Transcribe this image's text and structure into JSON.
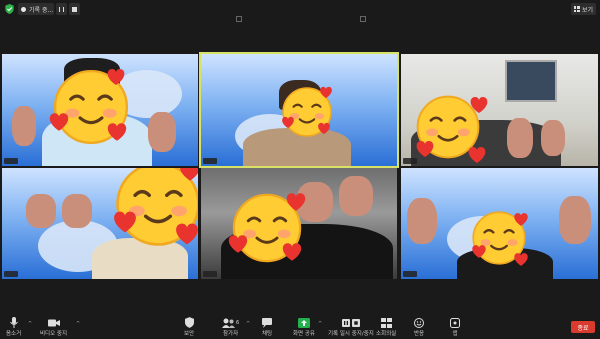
{
  "top_bar": {
    "recording_label": "기록 중...",
    "view_label": "보기",
    "view_icon": "grid-icon",
    "security_icon": "shield-check-icon",
    "security_color": "#2db34a"
  },
  "participants": [
    {
      "background": "virtual-sky",
      "emoji": "smiling-face-with-hearts"
    },
    {
      "background": "virtual-sky",
      "emoji": "smiling-face-with-hearts",
      "active_speaker": true
    },
    {
      "background": "office",
      "emoji": "smiling-face-with-hearts"
    },
    {
      "background": "virtual-sky",
      "emoji": "smiling-face-with-hearts"
    },
    {
      "background": "mall",
      "emoji": "smiling-face-with-hearts"
    },
    {
      "background": "virtual-sky",
      "emoji": "smiling-face-with-hearts"
    }
  ],
  "toolbar": {
    "mute_label": "음소거",
    "video_label": "비디오 중지",
    "security_label": "보안",
    "participants_label": "참가자",
    "participants_count": "6",
    "chat_label": "채팅",
    "share_label": "화면 공유",
    "record_label": "기록 일시 중지/중지",
    "rooms_label": "소회의실",
    "reactions_label": "반응",
    "apps_label": "앱",
    "end_label": "종료",
    "share_color": "#22b14c",
    "end_color": "#d93b2f",
    "active_outline_color": "#d8e266"
  }
}
